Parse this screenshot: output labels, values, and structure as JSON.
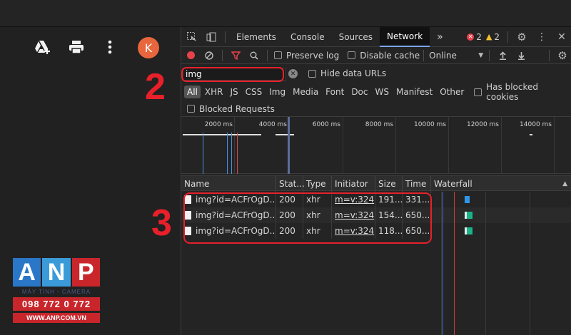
{
  "left_panel": {
    "avatar_letter": "K",
    "icons": [
      "drive-add-icon",
      "printer-icon",
      "more-vert-icon"
    ]
  },
  "annotations": {
    "step2": "2",
    "step3": "3"
  },
  "logo": {
    "letters": [
      "A",
      "N",
      "P"
    ],
    "tagline": "MÁY TÍNH - CAMERA",
    "phone": "098 772 0 772",
    "website": "WWW.ANP.COM.VN"
  },
  "devtools": {
    "tabs": [
      {
        "label": "Elements",
        "active": false
      },
      {
        "label": "Console",
        "active": false
      },
      {
        "label": "Sources",
        "active": false
      },
      {
        "label": "Network",
        "active": true
      }
    ],
    "more_tabs": "»",
    "error_count": "2",
    "warning_count": "2",
    "toolbar": {
      "preserve_log": "Preserve log",
      "disable_cache": "Disable cache",
      "throttling": "Online"
    },
    "filter": {
      "value": "img",
      "hide_data_urls": "Hide data URLs"
    },
    "types": [
      "All",
      "XHR",
      "JS",
      "CSS",
      "Img",
      "Media",
      "Font",
      "Doc",
      "WS",
      "Manifest",
      "Other"
    ],
    "has_blocked_cookies": "Has blocked cookies",
    "blocked_requests": "Blocked Requests",
    "overview_ticks": [
      "2000 ms",
      "4000 ms",
      "6000 ms",
      "8000 ms",
      "10000 ms",
      "12000 ms",
      "14000 ms"
    ],
    "columns": [
      "Name",
      "Stat...",
      "Type",
      "Initiator",
      "Size",
      "Time",
      "Waterfall"
    ],
    "rows": [
      {
        "name": "img?id=ACFrOgD...",
        "status": "200",
        "type": "xhr",
        "initiator": "m=v:324",
        "size": "191...",
        "time": "331..."
      },
      {
        "name": "img?id=ACFrOgD...",
        "status": "200",
        "type": "xhr",
        "initiator": "m=v:324",
        "size": "154...",
        "time": "650..."
      },
      {
        "name": "img?id=ACFrOgD...",
        "status": "200",
        "type": "xhr",
        "initiator": "m=v:324",
        "size": "118...",
        "time": "650..."
      }
    ]
  }
}
